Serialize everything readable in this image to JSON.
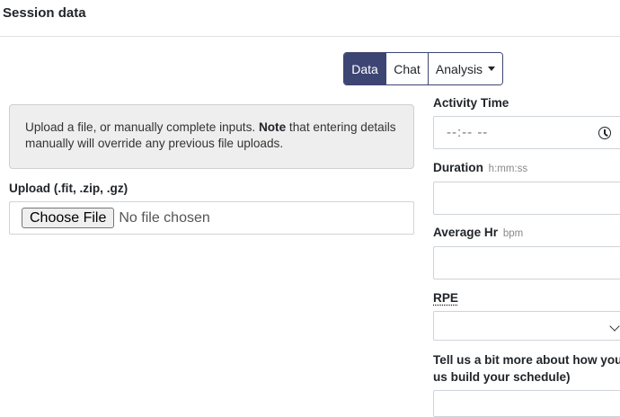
{
  "header": {
    "title": "Session data"
  },
  "tabs": [
    {
      "label": "Data",
      "active": true
    },
    {
      "label": "Chat",
      "active": false
    },
    {
      "label": "Analysis",
      "active": false
    }
  ],
  "alert": {
    "text_before": "Upload a file, or manually complete inputs. ",
    "bold": "Note",
    "text_after": " that entering details manually will override any previous file uploads."
  },
  "upload": {
    "label": "Upload (.fit, .zip, .gz)",
    "button_label": "Choose File",
    "status": "No file chosen"
  },
  "form": {
    "activity_time": {
      "label": "Activity Time",
      "placeholder": "--:-- --"
    },
    "duration": {
      "label": "Duration",
      "hint": "h:mm:ss",
      "value": ""
    },
    "average_hr": {
      "label": "Average Hr",
      "hint": "bpm",
      "value": ""
    },
    "rpe": {
      "label": "RPE",
      "selected": ""
    },
    "notes": {
      "label_line1": "Tell us a bit more about how you f",
      "label_line2": "us build your schedule)"
    }
  },
  "colors": {
    "accent": "#3d4573",
    "alert_bg": "#eeeeee"
  }
}
